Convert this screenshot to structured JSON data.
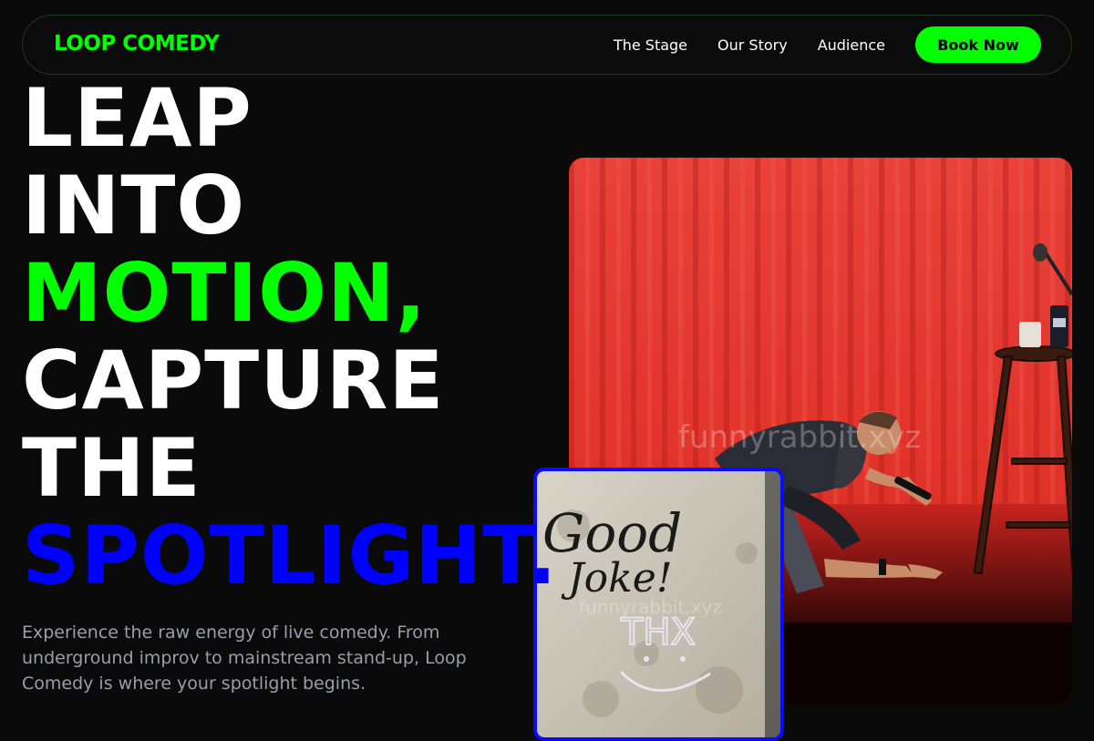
{
  "brand": {
    "logo_text": "LOOP COMEDY"
  },
  "nav": {
    "links": [
      "The Stage",
      "Our Story",
      "Audience"
    ],
    "cta_label": "Book Now"
  },
  "hero": {
    "headline_lines": [
      "LEAP",
      "INTO",
      "MOTION,",
      "CAPTURE",
      "THE",
      "SPOTLIGHT."
    ],
    "description": "Experience the raw energy of live comedy. From underground improv to mainstream stand-up, Loop Comedy is where your spotlight begins."
  },
  "images": {
    "main_watermark": "funnyrabbit.xyz",
    "small_watermark": "funnyrabbit.xyz",
    "small_graffiti_line1": "Good",
    "small_graffiti_line2": "Joke!",
    "small_graffiti_line3": "THX"
  },
  "colors": {
    "background": "#0a0a0a",
    "accent_green": "#00ff00",
    "accent_blue": "#0000ff",
    "body_text": "#9a9ea8",
    "curtain_red": "#e8322e"
  }
}
